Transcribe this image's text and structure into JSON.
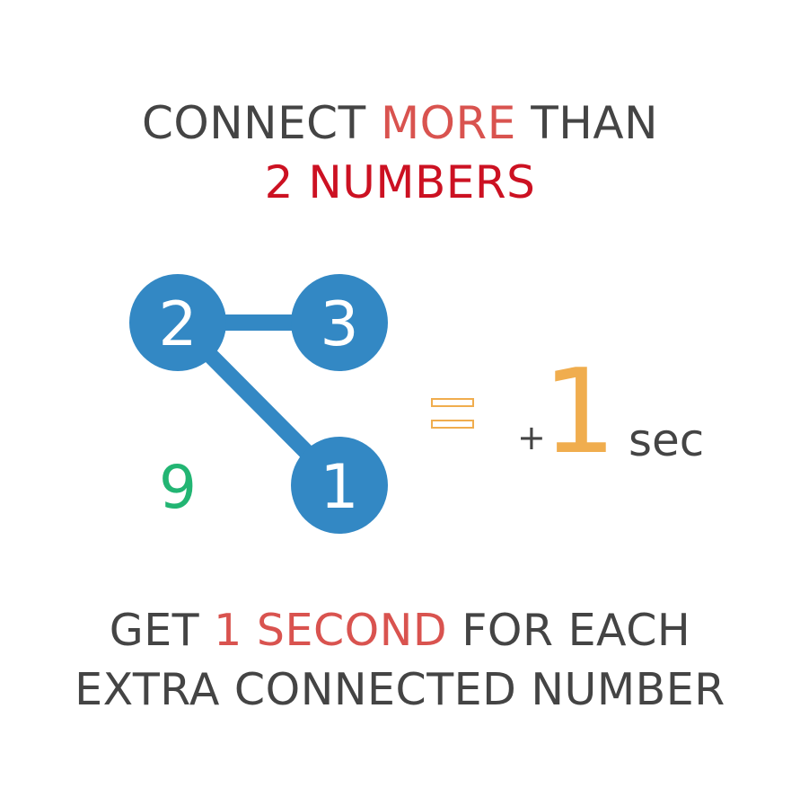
{
  "header": {
    "part1": "CONNECT ",
    "part2": "MORE",
    "part3": " THAN",
    "line2": "2 NUMBERS"
  },
  "nodes": [
    {
      "label": "2"
    },
    {
      "label": "3"
    },
    {
      "label": "1"
    }
  ],
  "loose_number": "9",
  "reward": {
    "plus": "+",
    "value": "1",
    "unit": "sec"
  },
  "footer": {
    "part1": "GET ",
    "part2": "1 SECOND",
    "part3": " FOR EACH",
    "line2": "EXTRA CONNECTED NUMBER"
  },
  "colors": {
    "node": "#3388c4",
    "node_text": "#ffffff",
    "loose_number": "#22b573",
    "accent_soft": "#d9534f",
    "accent_strong": "#cc1122",
    "reward": "#f0ad4e",
    "text": "#444444"
  }
}
